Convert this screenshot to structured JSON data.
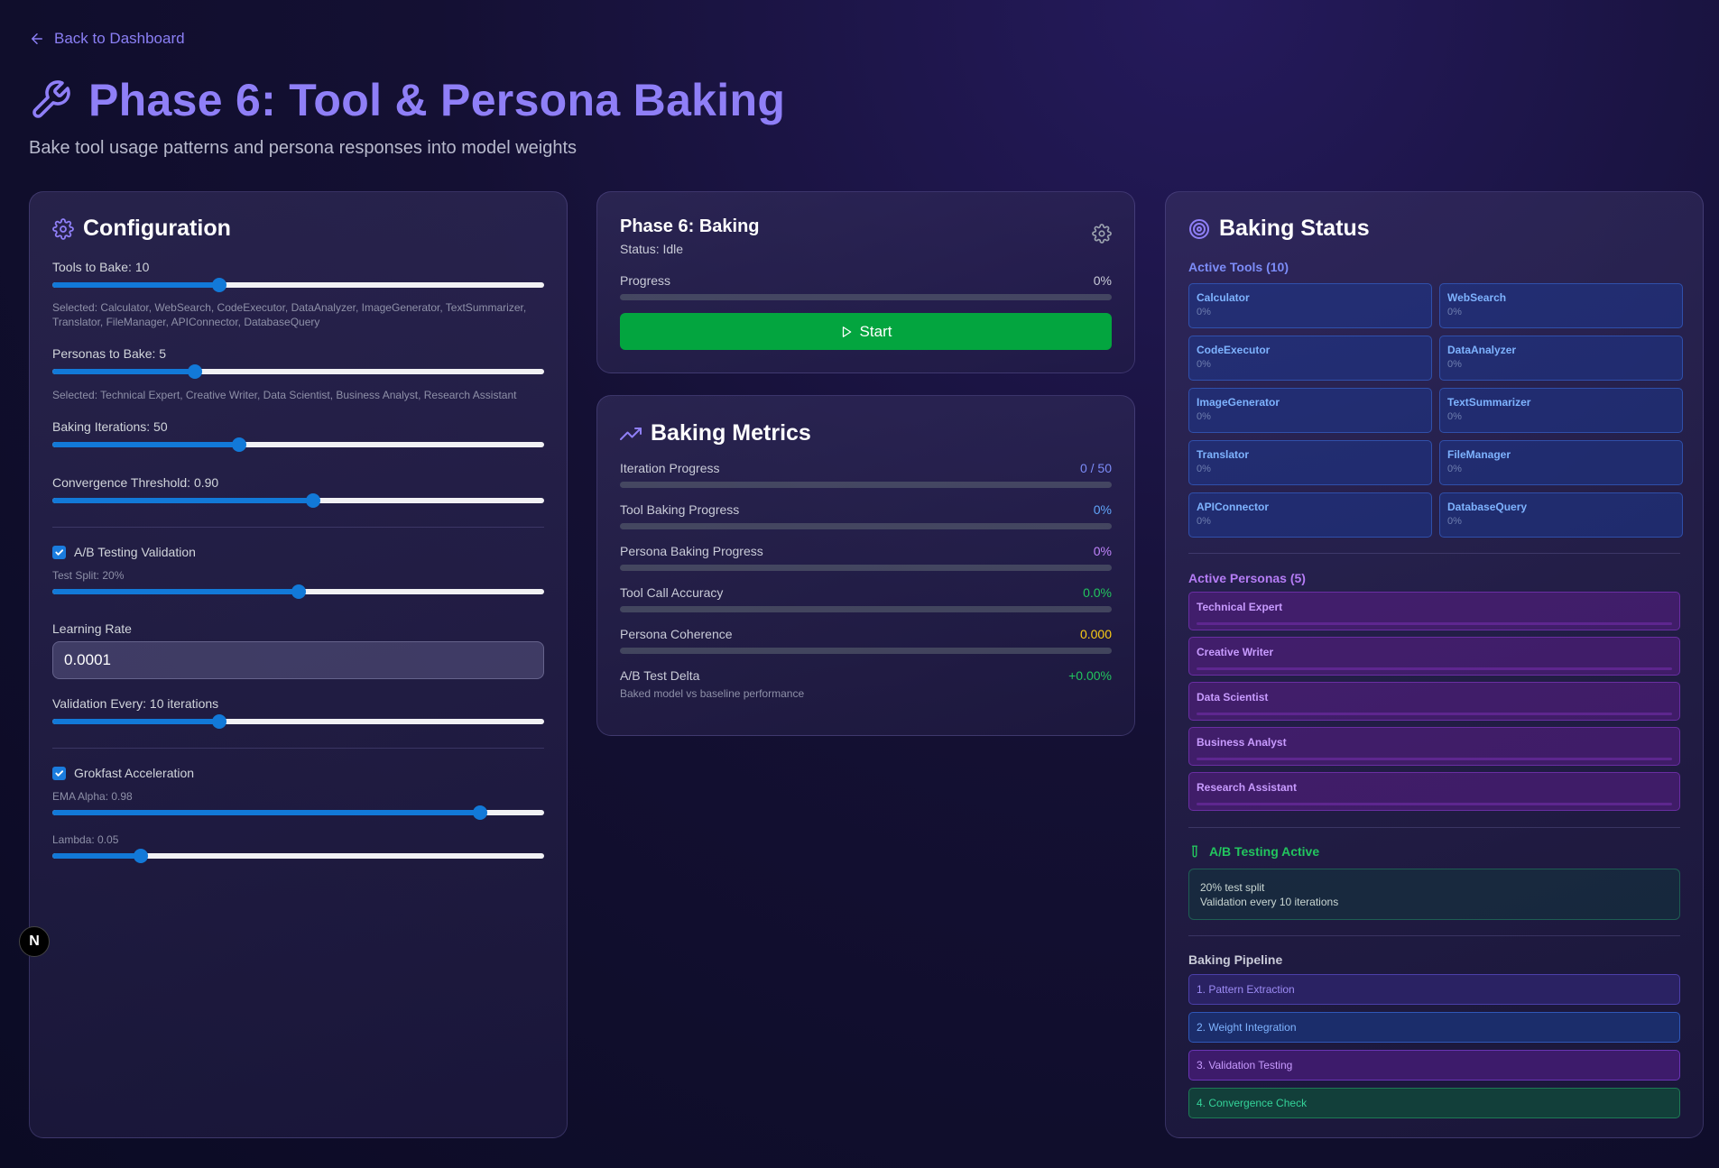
{
  "nav": {
    "back_label": "Back to Dashboard"
  },
  "header": {
    "title": "Phase 6: Tool & Persona Baking",
    "subtitle": "Bake tool usage patterns and persona responses into model weights"
  },
  "config": {
    "title": "Configuration",
    "tools_label": "Tools to Bake: 10",
    "tools_value": 0.34,
    "tools_selected": "Selected: Calculator, WebSearch, CodeExecutor, DataAnalyzer, ImageGenerator, TextSummarizer, Translator, FileManager, APIConnector, DatabaseQuery",
    "personas_label": "Personas to Bake: 5",
    "personas_value": 0.29,
    "personas_selected": "Selected: Technical Expert, Creative Writer, Data Scientist, Business Analyst, Research Assistant",
    "iterations_label": "Baking Iterations: 50",
    "iterations_value": 0.38,
    "convergence_label": "Convergence Threshold: 0.90",
    "convergence_value": 0.53,
    "ab_label": "A/B Testing Validation",
    "ab_checked": true,
    "test_split_label": "Test Split: 20%",
    "test_split_value": 0.5,
    "lr_label": "Learning Rate",
    "lr_value": "0.0001",
    "validation_label": "Validation Every: 10 iterations",
    "validation_value": 0.34,
    "grokfast_label": "Grokfast Acceleration",
    "grokfast_checked": true,
    "ema_label": "EMA Alpha: 0.98",
    "ema_value": 0.87,
    "lambda_label": "Lambda: 0.05",
    "lambda_value": 0.18
  },
  "phase": {
    "title": "Phase 6: Baking",
    "status": "Status: Idle",
    "progress_label": "Progress",
    "progress_value": "0%",
    "start_label": "Start"
  },
  "metrics": {
    "title": "Baking Metrics",
    "items": [
      {
        "label": "Iteration Progress",
        "value": "0 / 50",
        "color": "#7c8cf8"
      },
      {
        "label": "Tool Baking Progress",
        "value": "0%",
        "color": "#60a5fa"
      },
      {
        "label": "Persona Baking Progress",
        "value": "0%",
        "color": "#c084fc"
      },
      {
        "label": "Tool Call Accuracy",
        "value": "0.0%",
        "color": "#22c55e"
      },
      {
        "label": "Persona Coherence",
        "value": "0.000",
        "color": "#facc15"
      }
    ],
    "ab_label": "A/B Test Delta",
    "ab_value": "+0.00%",
    "ab_note": "Baked model vs baseline performance"
  },
  "status": {
    "title": "Baking Status",
    "tools_heading": "Active Tools (10)",
    "tools": [
      {
        "name": "Calculator",
        "pct": "0%"
      },
      {
        "name": "WebSearch",
        "pct": "0%"
      },
      {
        "name": "CodeExecutor",
        "pct": "0%"
      },
      {
        "name": "DataAnalyzer",
        "pct": "0%"
      },
      {
        "name": "ImageGenerator",
        "pct": "0%"
      },
      {
        "name": "TextSummarizer",
        "pct": "0%"
      },
      {
        "name": "Translator",
        "pct": "0%"
      },
      {
        "name": "FileManager",
        "pct": "0%"
      },
      {
        "name": "APIConnector",
        "pct": "0%"
      },
      {
        "name": "DatabaseQuery",
        "pct": "0%"
      }
    ],
    "personas_heading": "Active Personas (5)",
    "personas": [
      "Technical Expert",
      "Creative Writer",
      "Data Scientist",
      "Business Analyst",
      "Research Assistant"
    ],
    "ab_heading": "A/B Testing Active",
    "ab_line1": "20% test split",
    "ab_line2": "Validation every 10 iterations",
    "pipeline_heading": "Baking Pipeline",
    "pipeline": [
      {
        "label": "1. Pattern Extraction",
        "bg": "#2a2263",
        "border": "#4b3fa8",
        "color": "#9d8cf5"
      },
      {
        "label": "2. Weight Integration",
        "bg": "#1b2d6b",
        "border": "#2f57b8",
        "color": "#7eb3ff"
      },
      {
        "label": "3. Validation Testing",
        "bg": "#3d1b6b",
        "border": "#6a34b5",
        "color": "#c89bff"
      },
      {
        "label": "4. Convergence Check",
        "bg": "#123f3a",
        "border": "#1e7a55",
        "color": "#34d399"
      }
    ]
  },
  "badge": "N"
}
